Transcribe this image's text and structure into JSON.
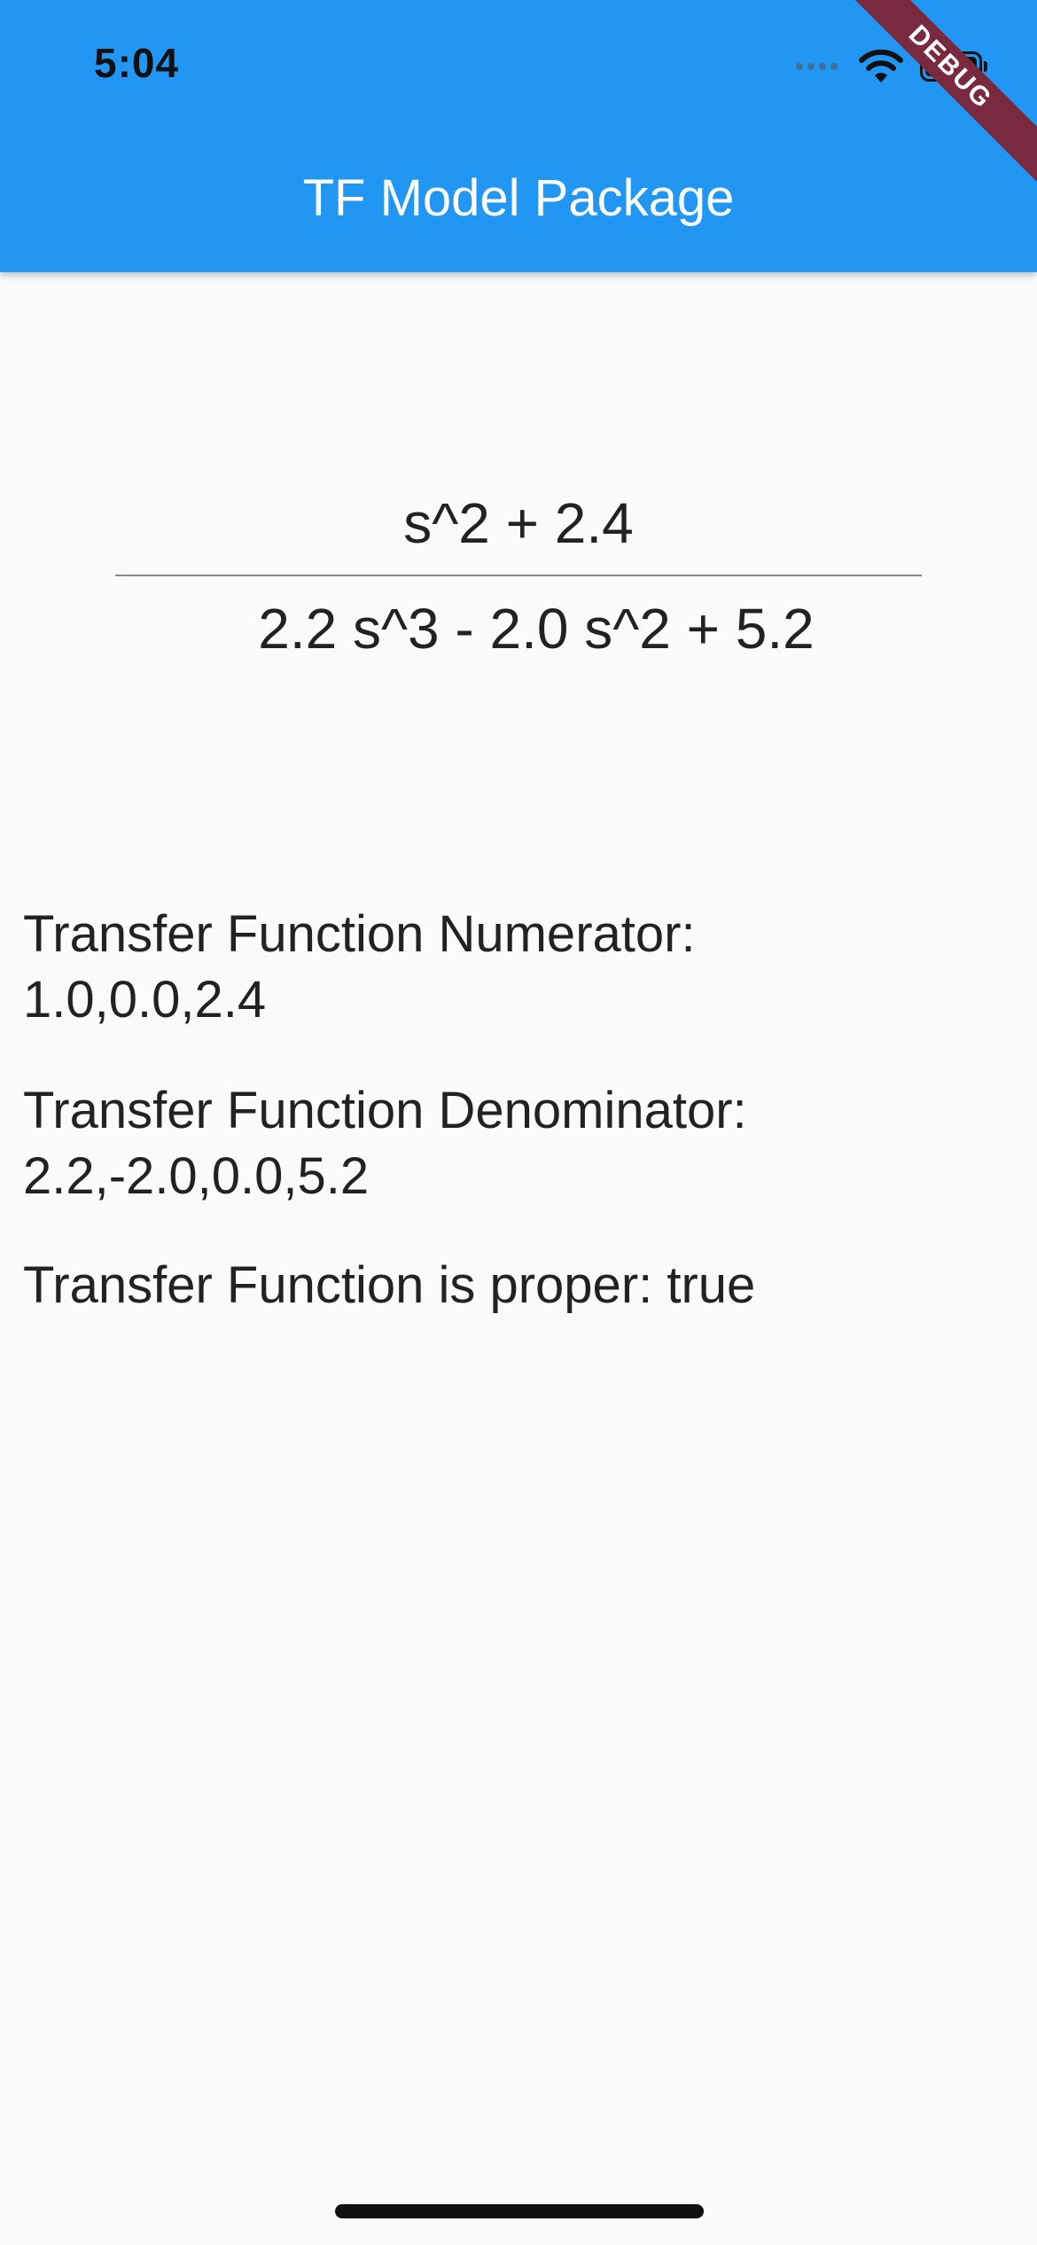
{
  "status_bar": {
    "time": "5:04"
  },
  "app_bar": {
    "title": "TF Model Package",
    "color": "#2196f3"
  },
  "debug_banner": {
    "label": "DEBUG",
    "color": "#7a2a3e"
  },
  "fraction": {
    "numerator": "s^2 + 2.4",
    "denominator": "2.2 s^3 - 2.0 s^2 + 5.2"
  },
  "info": {
    "numerator_label": "Transfer Function Numerator:",
    "numerator_value": "1.0,0.0,2.4",
    "denominator_label": "Transfer Function Denominator:",
    "denominator_value": "2.2,-2.0,0.0,5.2",
    "proper_text": "Transfer Function is proper: true"
  },
  "icons": [
    "signal-icon",
    "wifi-icon",
    "battery-icon"
  ]
}
